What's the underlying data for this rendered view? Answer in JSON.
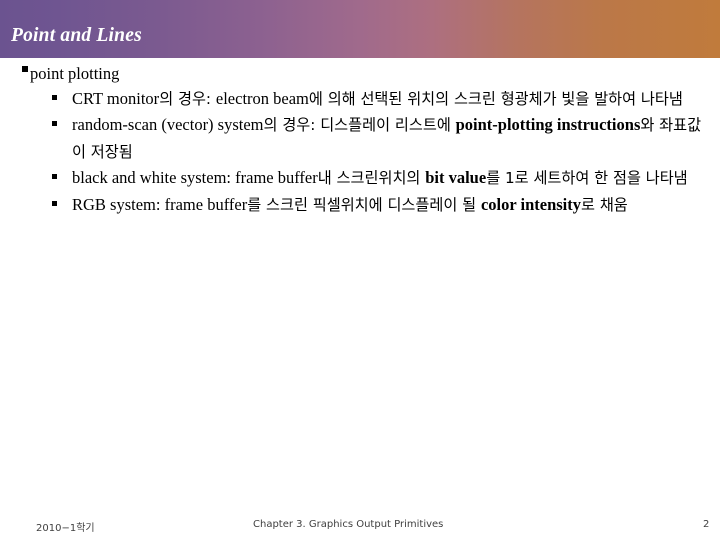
{
  "slide": {
    "title": "Point and Lines",
    "header_gradient_start": "#6b5390",
    "header_gradient_end": "#c07b3c",
    "text_color": "#000000",
    "title_color": "#ffffff"
  },
  "content": {
    "level1": [
      {
        "text": "point plotting"
      }
    ],
    "level2": [
      {
        "runs": [
          {
            "t": "CRT monitor",
            "k": "en"
          },
          {
            "t": "의 경우: ",
            "k": "ko"
          },
          {
            "t": "electron beam",
            "k": "en"
          },
          {
            "t": "에 의해 선택된 위치의 스크린 형광체가 빛을 발하여 나타냄",
            "k": "ko"
          }
        ]
      },
      {
        "runs": [
          {
            "t": "random-scan (vector) system",
            "k": "en"
          },
          {
            "t": "의 경우: 디스플레이 리스트에 ",
            "k": "ko"
          },
          {
            "t": "point-plotting instructions",
            "k": "en-b"
          },
          {
            "t": "와 좌표값이 저장됨",
            "k": "ko"
          }
        ]
      },
      {
        "runs": [
          {
            "t": "black and white system: frame buffer",
            "k": "en"
          },
          {
            "t": "내 스크린위치의 ",
            "k": "ko"
          },
          {
            "t": "bit value",
            "k": "en-b"
          },
          {
            "t": "를 1로 세트하여 한 점을 나타냄",
            "k": "ko"
          }
        ]
      },
      {
        "runs": [
          {
            "t": "RGB system: frame buffer",
            "k": "en"
          },
          {
            "t": "를 스크린 픽셀위치에 디스플레이 될 ",
            "k": "ko"
          },
          {
            "t": "color intensity",
            "k": "en-b"
          },
          {
            "t": "로 채움",
            "k": "ko"
          }
        ]
      }
    ]
  },
  "footer": {
    "left": "2010−1학기",
    "center": "Chapter 3. Graphics Output Primitives",
    "page_number": "2"
  }
}
